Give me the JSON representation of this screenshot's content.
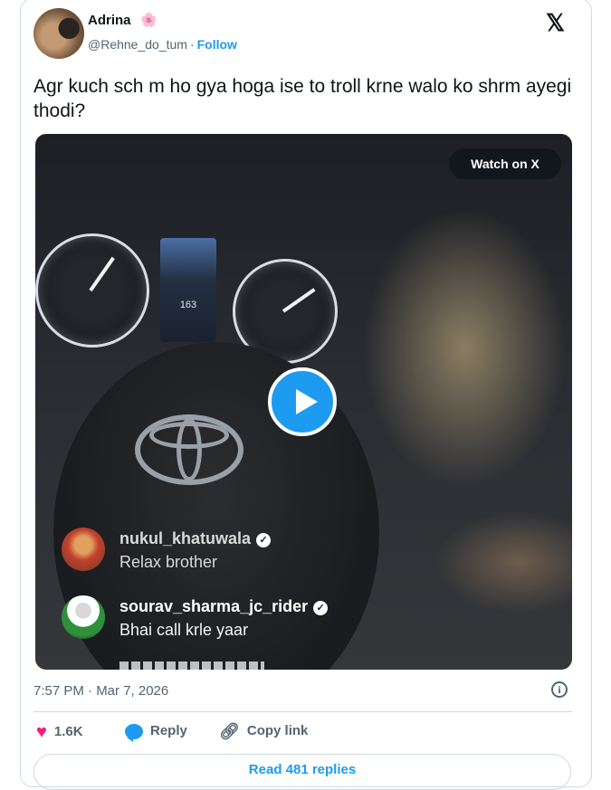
{
  "author": {
    "display_name": "Adrina",
    "emoji": "🌸",
    "handle": "@Rehne_do_tum",
    "separator": "·",
    "follow_label": "Follow"
  },
  "tweet": {
    "text": "Agr kuch sch m ho gya hoga ise to troll krne walo ko shrm ayegi thodi?"
  },
  "video": {
    "watch_label": "Watch on X",
    "speed_readout": "163",
    "comments": [
      {
        "user": "nukul_khatuwala",
        "text": "Relax brother"
      },
      {
        "user": "sourav_sharma_jc_rider",
        "text": "Bhai call krle yaar"
      }
    ]
  },
  "meta": {
    "timestamp": "7:57 PM · Mar 7, 2026"
  },
  "actions": {
    "likes": "1.6K",
    "reply_label": "Reply",
    "copy_link_label": "Copy link",
    "read_replies_label": "Read 481 replies"
  },
  "icons": {
    "brand": "x-logo",
    "info": "info-icon",
    "heart": "heart-icon",
    "reply": "reply-icon",
    "link": "link-icon",
    "play": "play-icon"
  },
  "colors": {
    "accent": "#1d9bf0",
    "like": "#f91880",
    "muted": "#536471"
  }
}
